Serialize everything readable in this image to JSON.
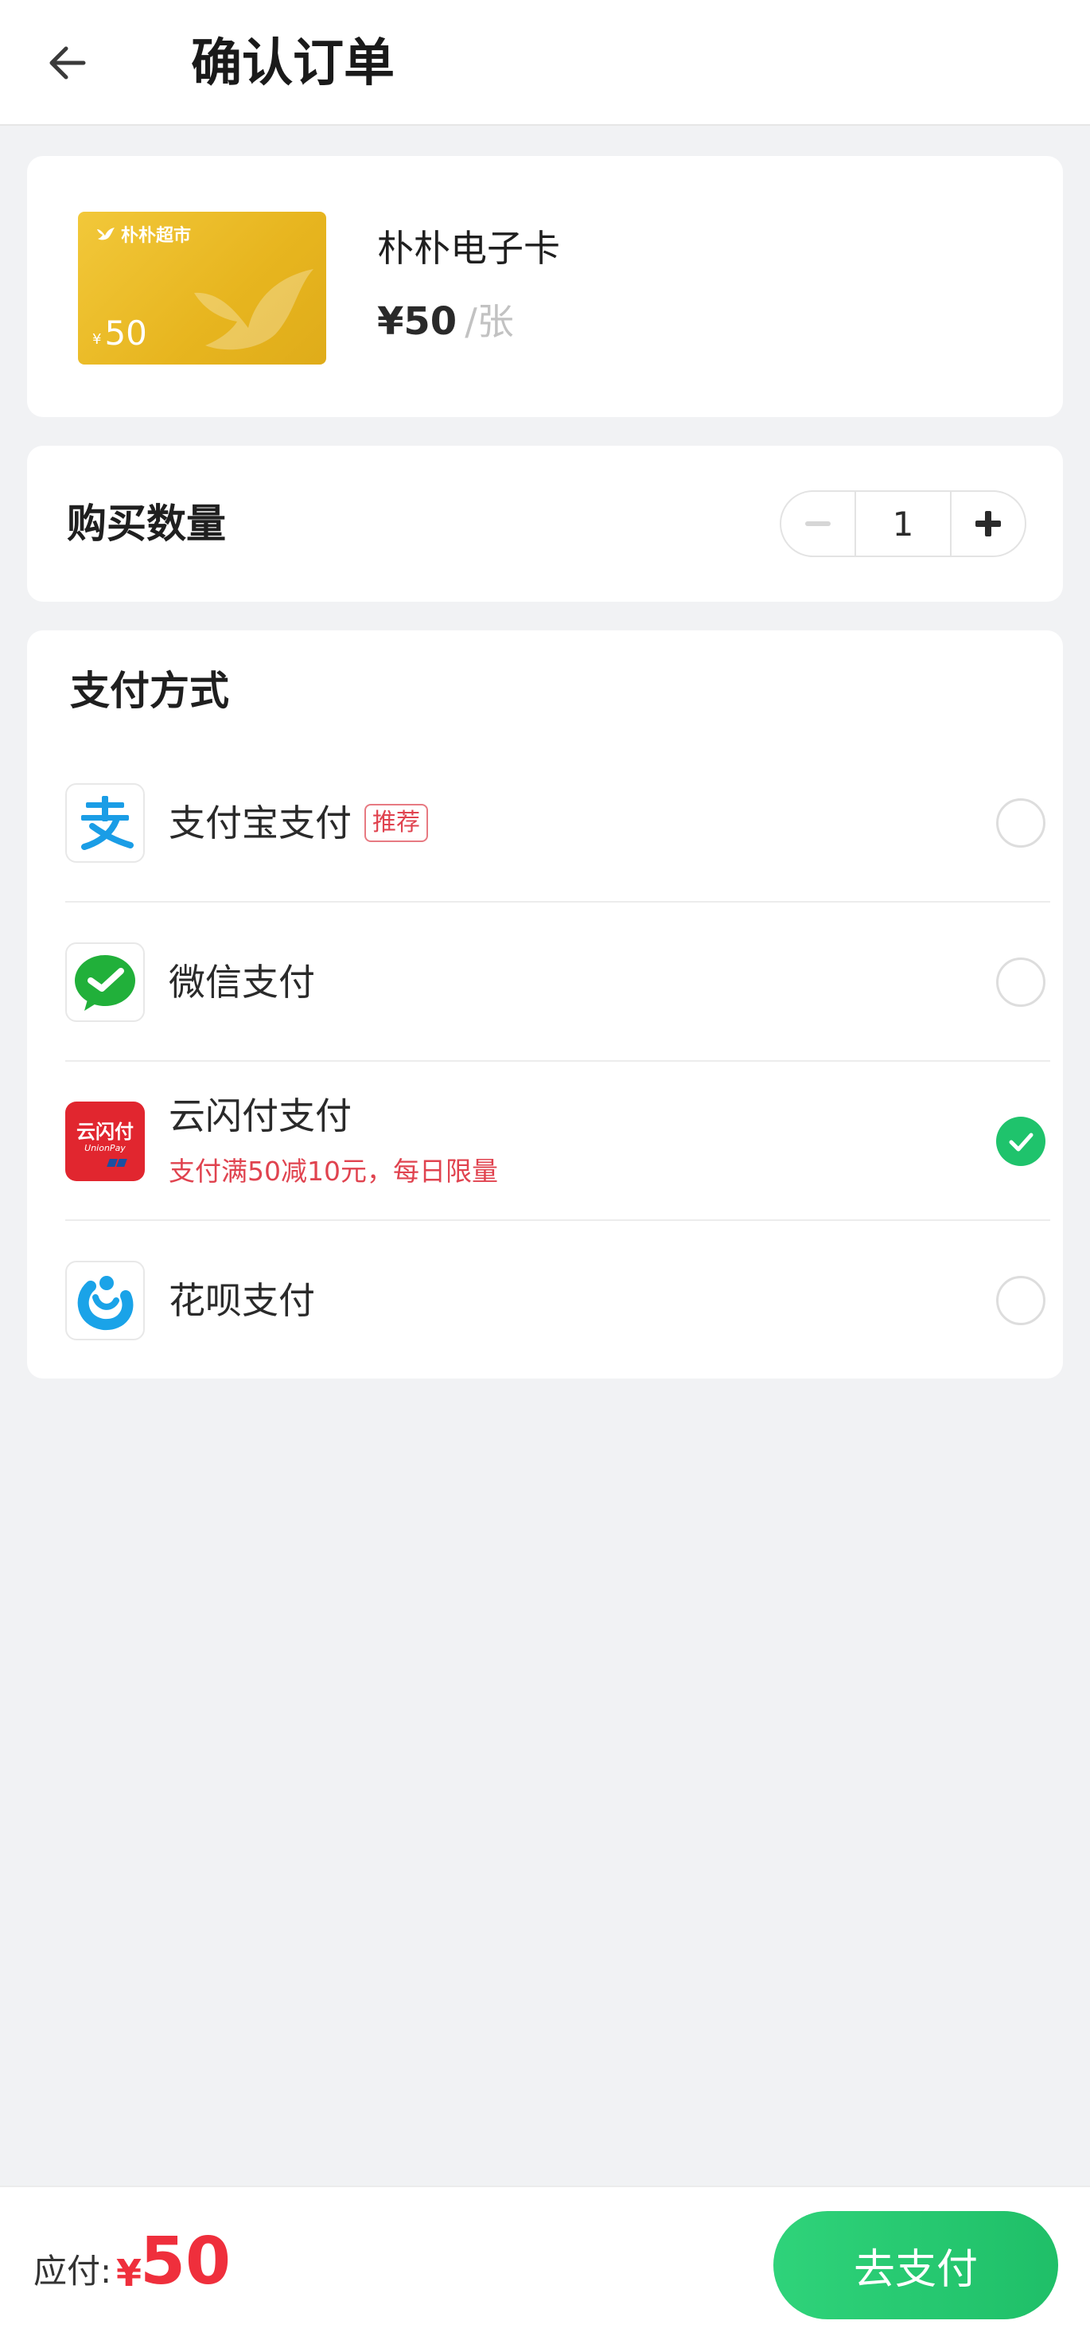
{
  "header": {
    "title": "确认订单"
  },
  "product": {
    "card_brand": "朴朴超市",
    "card_face_value": "50",
    "card_face_currency": "¥",
    "name": "朴朴电子卡",
    "price": "¥50",
    "unit": "/张"
  },
  "quantity": {
    "label": "购买数量",
    "value": "1"
  },
  "payment": {
    "title": "支付方式",
    "methods": [
      {
        "name": "支付宝支付",
        "badge": "推荐",
        "selected": false,
        "icon": "alipay-icon"
      },
      {
        "name": "微信支付",
        "selected": false,
        "icon": "wechat-pay-icon"
      },
      {
        "name": "云闪付支付",
        "promo": "支付满50减10元，每日限量",
        "selected": true,
        "icon": "unionpay-icon",
        "icon_text": "云闪付",
        "icon_subtext": "UnionPay"
      },
      {
        "name": "花呗支付",
        "selected": false,
        "icon": "huabei-icon"
      }
    ]
  },
  "footer": {
    "total_label": "应付:",
    "currency": "¥",
    "total": "50",
    "pay_button": "去支付"
  },
  "colors": {
    "accent_green": "#1fc36c",
    "price_red": "#ef2f3c",
    "card_gold": "#e9b823"
  }
}
